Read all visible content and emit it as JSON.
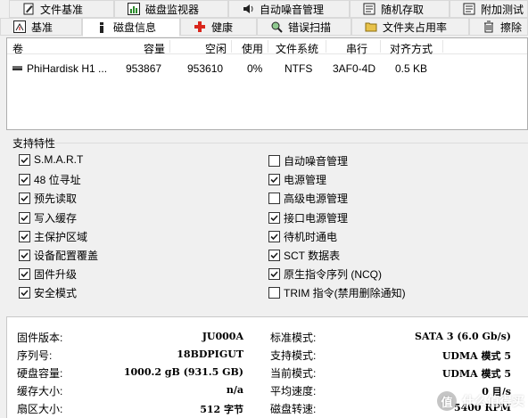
{
  "tabs_row1": [
    {
      "label": "文件基准",
      "icon": "pencil-icon"
    },
    {
      "label": "磁盘监视器",
      "icon": "chart-icon"
    },
    {
      "label": "自动噪音管理",
      "icon": "speaker-icon"
    },
    {
      "label": "随机存取",
      "icon": "document-icon"
    },
    {
      "label": "附加测试",
      "icon": "document-icon"
    }
  ],
  "tabs_row2": [
    {
      "label": "基准",
      "icon": "gauge-icon"
    },
    {
      "label": "磁盘信息",
      "icon": "info-icon",
      "active": true
    },
    {
      "label": "健康",
      "icon": "red-cross-icon"
    },
    {
      "label": "错误扫描",
      "icon": "magnifier-icon"
    },
    {
      "label": "文件夹占用率",
      "icon": "folder-icon"
    },
    {
      "label": "擦除",
      "icon": "trash-icon"
    }
  ],
  "drive_list": {
    "headers": [
      "卷",
      "容量",
      "空闲",
      "使用",
      "文件系统",
      "串行",
      "对齐方式"
    ],
    "rows": [
      {
        "volume": "PhiHardisk H1 ...",
        "capacity": "953867",
        "free": "953610",
        "used": "0%",
        "fs": "NTFS",
        "serial": "3AF0-4D",
        "alignment": "0.5 KB"
      }
    ]
  },
  "features": {
    "title": "支持特性",
    "left": [
      {
        "label": "S.M.A.R.T",
        "checked": true
      },
      {
        "label": "48 位寻址",
        "checked": true
      },
      {
        "label": "预先读取",
        "checked": true
      },
      {
        "label": "写入缓存",
        "checked": true
      },
      {
        "label": "主保护区域",
        "checked": true
      },
      {
        "label": "设备配置覆盖",
        "checked": true
      },
      {
        "label": "固件升级",
        "checked": true
      },
      {
        "label": "安全模式",
        "checked": true
      }
    ],
    "right": [
      {
        "label": "自动噪音管理",
        "checked": false
      },
      {
        "label": "电源管理",
        "checked": true
      },
      {
        "label": "高级电源管理",
        "checked": false
      },
      {
        "label": "接口电源管理",
        "checked": true
      },
      {
        "label": "待机时通电",
        "checked": true
      },
      {
        "label": "SCT 数据表",
        "checked": true
      },
      {
        "label": "原生指令序列 (NCQ)",
        "checked": true
      },
      {
        "label": "TRIM 指令(禁用删除通知)",
        "checked": false
      }
    ]
  },
  "info": {
    "left": [
      {
        "label": "固件版本:",
        "value": "JU000A"
      },
      {
        "label": "序列号:",
        "value": "18BDPIGUT"
      },
      {
        "label": "硬盘容量:",
        "value": "1000.2 gB (931.5 GB)"
      },
      {
        "label": "缓存大小:",
        "value": "n/a"
      },
      {
        "label": "扇区大小:",
        "value": "512 字节"
      }
    ],
    "right": [
      {
        "label": "标准模式:",
        "value": "SATA 3 (6.0 Gb/s)"
      },
      {
        "label": "支持模式:",
        "value": "UDMA 模式 5"
      },
      {
        "label": "当前模式:",
        "value": "UDMA 模式 5"
      },
      {
        "label": "平均速度:",
        "value": "0 目/s"
      },
      {
        "label": "磁盘转速:",
        "value": "5400 RPM"
      }
    ]
  },
  "watermark": {
    "badge": "值",
    "text": "什么值得买"
  },
  "colors": {
    "check": "#1a1a1a",
    "red_cross": "#d9261c",
    "info_blue": "#1e5fb8"
  }
}
